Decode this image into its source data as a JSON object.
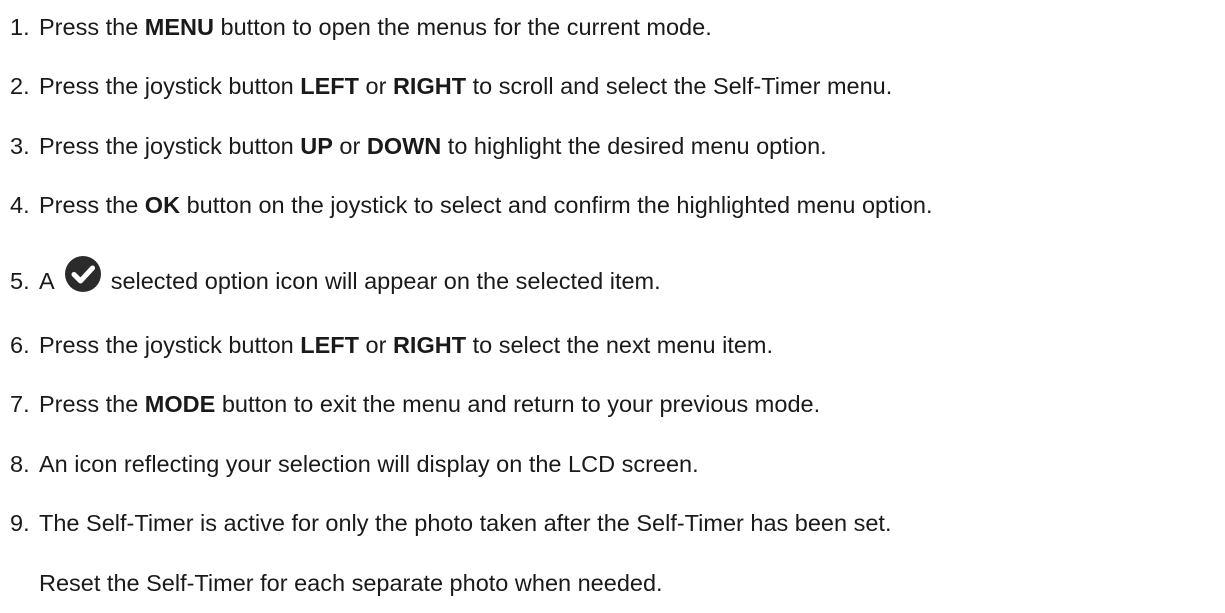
{
  "steps": [
    {
      "num": "1.",
      "parts": [
        {
          "text": "Press the "
        },
        {
          "text": "MENU",
          "bold": true
        },
        {
          "text": " button to open the menus for the current mode."
        }
      ]
    },
    {
      "num": "2.",
      "parts": [
        {
          "text": "Press the joystick button "
        },
        {
          "text": "LEFT",
          "bold": true
        },
        {
          "text": " or "
        },
        {
          "text": "RIGHT",
          "bold": true
        },
        {
          "text": " to scroll and select the Self-Timer menu."
        }
      ]
    },
    {
      "num": "3.",
      "parts": [
        {
          "text": "Press the joystick button "
        },
        {
          "text": "UP",
          "bold": true
        },
        {
          "text": " or "
        },
        {
          "text": "DOWN",
          "bold": true
        },
        {
          "text": " to highlight the desired menu option."
        }
      ]
    },
    {
      "num": "4.",
      "parts": [
        {
          "text": "Press the "
        },
        {
          "text": "OK",
          "bold": true
        },
        {
          "text": " button on the joystick to select and confirm the highlighted menu option."
        }
      ]
    },
    {
      "num": "5.",
      "parts": [
        {
          "text": "A"
        },
        {
          "icon": "check-circle-icon"
        },
        {
          "text": "selected option icon will appear on the selected item."
        }
      ]
    },
    {
      "num": "6.",
      "parts": [
        {
          "text": "Press the joystick button "
        },
        {
          "text": "LEFT",
          "bold": true
        },
        {
          "text": " or "
        },
        {
          "text": "RIGHT",
          "bold": true
        },
        {
          "text": " to select the next menu item."
        }
      ]
    },
    {
      "num": "7.",
      "parts": [
        {
          "text": "Press the "
        },
        {
          "text": "MODE",
          "bold": true
        },
        {
          "text": " button to exit the menu and return to your previous mode."
        }
      ]
    },
    {
      "num": "8.",
      "parts": [
        {
          "text": "An icon reflecting your selection will display on the LCD screen."
        }
      ]
    },
    {
      "num": "9.",
      "parts": [
        {
          "text": "The Self-Timer is active for only the photo taken after the Self-Timer has been set."
        }
      ]
    }
  ],
  "continuation": "Reset the Self-Timer for each separate photo when needed.",
  "colors": {
    "text": "#1a1a1a",
    "icon_fill": "#2b2b2b"
  }
}
